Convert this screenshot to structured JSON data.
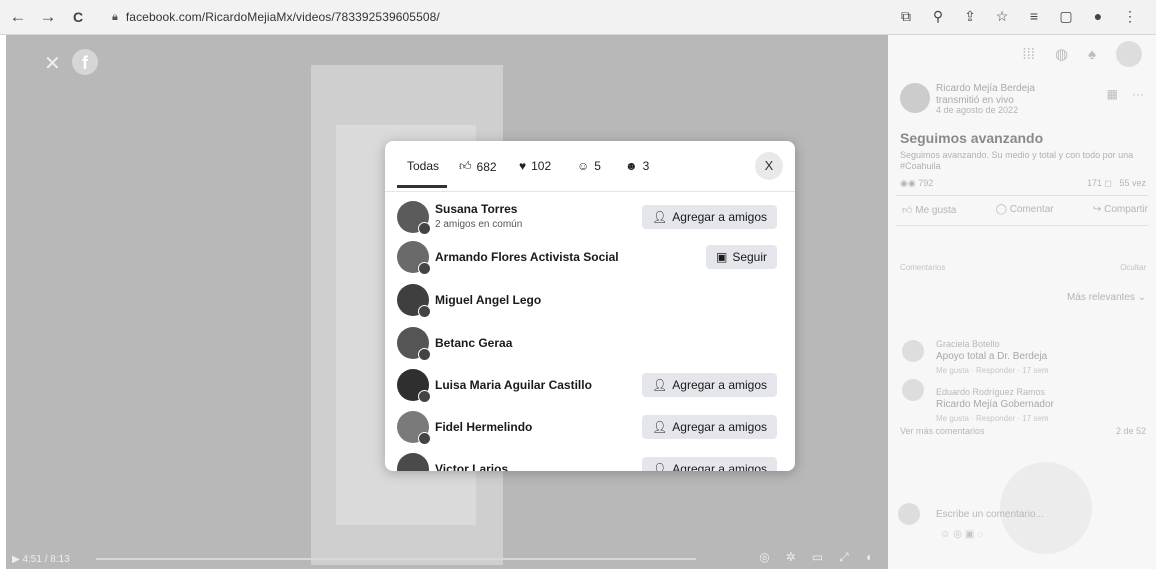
{
  "browser": {
    "back_icon": "←",
    "forward_icon": "→",
    "reload_icon": "C",
    "url": "facebook.com/RicardoMejiaMx/videos/783392539605508/",
    "toolbar_icons": [
      "⧉",
      "⚲",
      "⇪",
      "☆",
      "≡",
      "▢",
      "●",
      "⋮"
    ]
  },
  "video": {
    "time": "4:51 / 8:13"
  },
  "reactions_modal": {
    "tabs": [
      {
        "label": "Todas",
        "icon": ""
      },
      {
        "label": "682",
        "icon": "like-reaction"
      },
      {
        "label": "102",
        "icon": "love-reaction"
      },
      {
        "label": "5",
        "icon": "care-reaction"
      },
      {
        "label": "3",
        "icon": "wow-reaction"
      }
    ],
    "close_label": "X",
    "people": [
      {
        "name": "Susana Torres",
        "sub": "2 amigos en común",
        "button": "Agregar a amigos",
        "button_icon": "add-friend-icon"
      },
      {
        "name": "Armando Flores Activista Social",
        "sub": "",
        "button": "Seguir",
        "button_icon": "follow-icon"
      },
      {
        "name": "Miguel Angel Lego",
        "sub": "",
        "button": "",
        "button_icon": ""
      },
      {
        "name": "Betanc Geraa",
        "sub": "",
        "button": "",
        "button_icon": ""
      },
      {
        "name": "Luisa Maria Aguilar Castillo",
        "sub": "",
        "button": "Agregar a amigos",
        "button_icon": "add-friend-icon"
      },
      {
        "name": "Fidel Hermelindo",
        "sub": "",
        "button": "Agregar a amigos",
        "button_icon": "add-friend-icon"
      },
      {
        "name": "Victor Larios",
        "sub": "",
        "button": "Agregar a amigos",
        "button_icon": "add-friend-icon"
      }
    ]
  },
  "side_panel": {
    "poster_name": "Ricardo Mejía Berdeja",
    "poster_status": "transmitió en vivo",
    "post_date": "4 de agosto de 2022",
    "post_title": "Seguimos avanzando",
    "post_body": "Seguimos avanzando. Su medio y total y con todo por una #Coahuila",
    "reactions_count": "792",
    "comments_count": "171",
    "shares_count": "55 vez",
    "action_like": "Me gusta",
    "action_comment": "Comentar",
    "action_share": "Compartir",
    "comments_label": "Comentarios",
    "comments_right": "Ocultar",
    "relevant_label": "Más relevantes ⌄",
    "comments": [
      {
        "name": "Graciela Botello",
        "text": "Apoyo total a Dr. Berdeja",
        "actions": "Me gusta · Responder · 17 sem"
      },
      {
        "name": "Eduardo Rodríguez Ramos",
        "text": "Ricardo Mejía Gobernador",
        "actions": "Me gusta · Responder · 17 sem"
      }
    ],
    "more_comments": "Ver más comentarios",
    "more_count": "2 de 52",
    "write_placeholder": "Escribe un comentario..."
  }
}
